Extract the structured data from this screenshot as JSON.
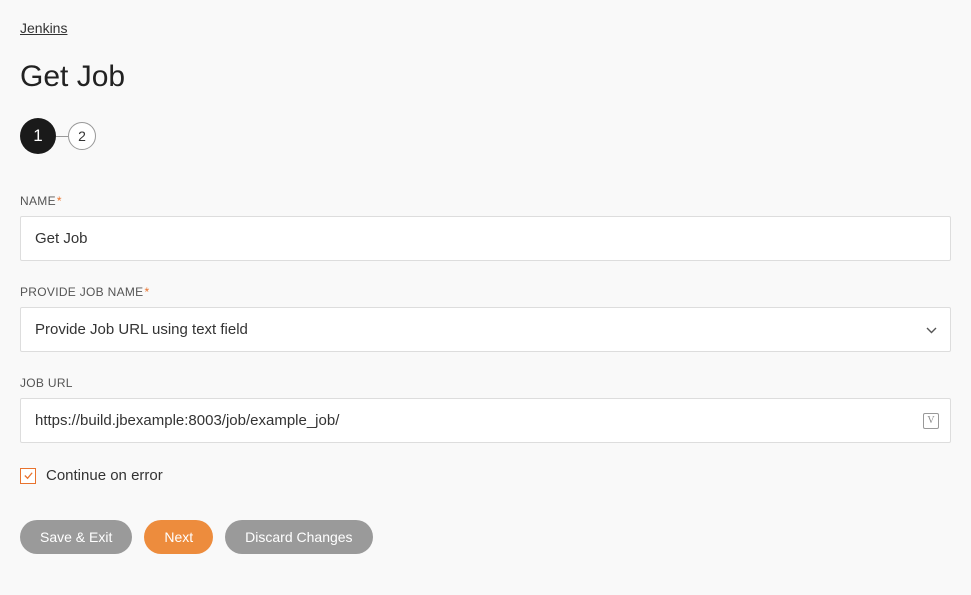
{
  "breadcrumb": {
    "label": "Jenkins"
  },
  "page": {
    "title": "Get Job"
  },
  "stepper": {
    "steps": [
      "1",
      "2"
    ],
    "active": 0
  },
  "fields": {
    "name": {
      "label": "NAME",
      "required": true,
      "value": "Get Job"
    },
    "provide_job_name": {
      "label": "PROVIDE JOB NAME",
      "required": true,
      "value": "Provide Job URL using text field"
    },
    "job_url": {
      "label": "JOB URL",
      "required": false,
      "value": "https://build.jbexample:8003/job/example_job/"
    }
  },
  "checkbox": {
    "continue_on_error": {
      "label": "Continue on error",
      "checked": true
    }
  },
  "buttons": {
    "save_exit": "Save & Exit",
    "next": "Next",
    "discard": "Discard Changes"
  },
  "required_marker": "*"
}
